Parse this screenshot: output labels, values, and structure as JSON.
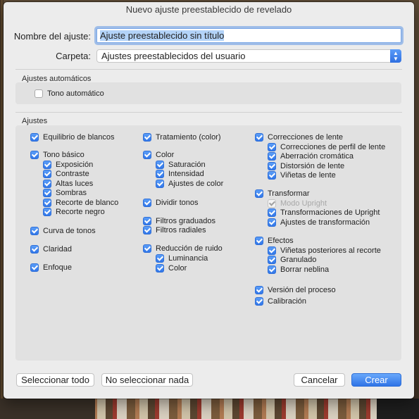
{
  "dialog": {
    "title": "Nuevo ajuste preestablecido de revelado",
    "name_label": "Nombre del ajuste:",
    "name_value": "Ajuste preestablecido sin título",
    "folder_label": "Carpeta:",
    "folder_value": "Ajustes preestablecidos del usuario"
  },
  "auto_section": {
    "title": "Ajustes automáticos",
    "auto_tone": {
      "label": "Tono automático",
      "checked": false
    }
  },
  "settings_section": {
    "title": "Ajustes",
    "col1": {
      "white_balance": "Equilibrio de blancos",
      "basic_tone": "Tono básico",
      "exposure": "Exposición",
      "contrast": "Contraste",
      "highlights": "Altas luces",
      "shadows": "Sombras",
      "white_clip": "Recorte de blanco",
      "black_clip": "Recorte negro",
      "tone_curve": "Curva de tonos",
      "clarity": "Claridad",
      "sharpening": "Enfoque"
    },
    "col2": {
      "treatment": "Tratamiento (color)",
      "color": "Color",
      "saturation": "Saturación",
      "vibrance": "Intensidad",
      "color_adjust": "Ajustes de color",
      "split_toning": "Dividir tonos",
      "graduated_filters": "Filtros graduados",
      "radial_filters": "Filtros radiales",
      "noise_reduction": "Reducción de ruido",
      "luminance": "Luminancia",
      "nr_color": "Color"
    },
    "col3": {
      "lens_corrections": "Correcciones de lente",
      "lens_profile": "Correcciones de perfil de lente",
      "chromatic_aberration": "Aberración cromática",
      "lens_distortion": "Distorsión de lente",
      "lens_vignetting": "Viñetas de lente",
      "transform": "Transformar",
      "upright_mode": "Modo Upright",
      "upright_transforms": "Transformaciones de Upright",
      "transform_adjust": "Ajustes de transformación",
      "effects": "Efectos",
      "post_crop_vignette": "Viñetas posteriores al recorte",
      "grain": "Granulado",
      "dehaze": "Borrar neblina",
      "process_version": "Versión del proceso",
      "calibration": "Calibración"
    }
  },
  "buttons": {
    "select_all": "Seleccionar todo",
    "select_none": "No seleccionar nada",
    "cancel": "Cancelar",
    "create": "Crear"
  },
  "colors": {
    "accent": "#3478f0",
    "panel": "#e1e1e1",
    "dialog": "#ececec"
  }
}
